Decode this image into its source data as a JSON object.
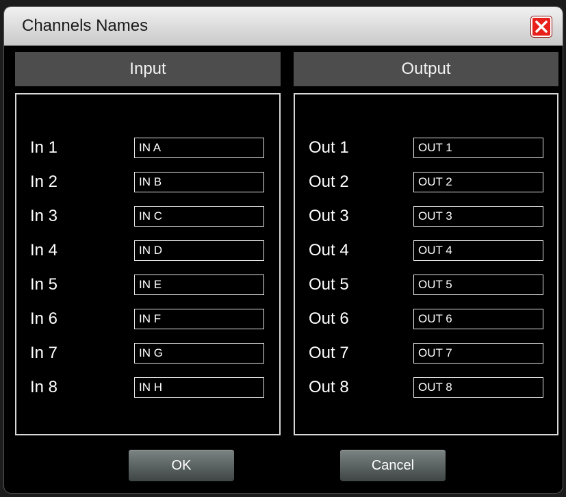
{
  "dialog": {
    "title": "Channels Names"
  },
  "input_panel": {
    "header": "Input",
    "rows": [
      {
        "label": "In 1",
        "value": "IN A"
      },
      {
        "label": "In 2",
        "value": "IN B"
      },
      {
        "label": "In 3",
        "value": "IN C"
      },
      {
        "label": "In 4",
        "value": "IN D"
      },
      {
        "label": "In 5",
        "value": "IN E"
      },
      {
        "label": "In 6",
        "value": "IN F"
      },
      {
        "label": "In 7",
        "value": "IN G"
      },
      {
        "label": "In 8",
        "value": "IN H"
      }
    ]
  },
  "output_panel": {
    "header": "Output",
    "rows": [
      {
        "label": "Out 1",
        "value": "OUT 1"
      },
      {
        "label": "Out 2",
        "value": "OUT 2"
      },
      {
        "label": "Out 3",
        "value": "OUT 3"
      },
      {
        "label": "Out 4",
        "value": "OUT 4"
      },
      {
        "label": "Out 5",
        "value": "OUT 5"
      },
      {
        "label": "Out 6",
        "value": "OUT 6"
      },
      {
        "label": "Out 7",
        "value": "OUT 7"
      },
      {
        "label": "Out 8",
        "value": "OUT 8"
      }
    ]
  },
  "buttons": {
    "ok_label": "OK",
    "cancel_label": "Cancel"
  },
  "icons": {
    "close": "close-icon"
  },
  "colors": {
    "close_button": "#e8201c",
    "panel_header": "#4d4d4d",
    "dialog_background": "#000000"
  }
}
